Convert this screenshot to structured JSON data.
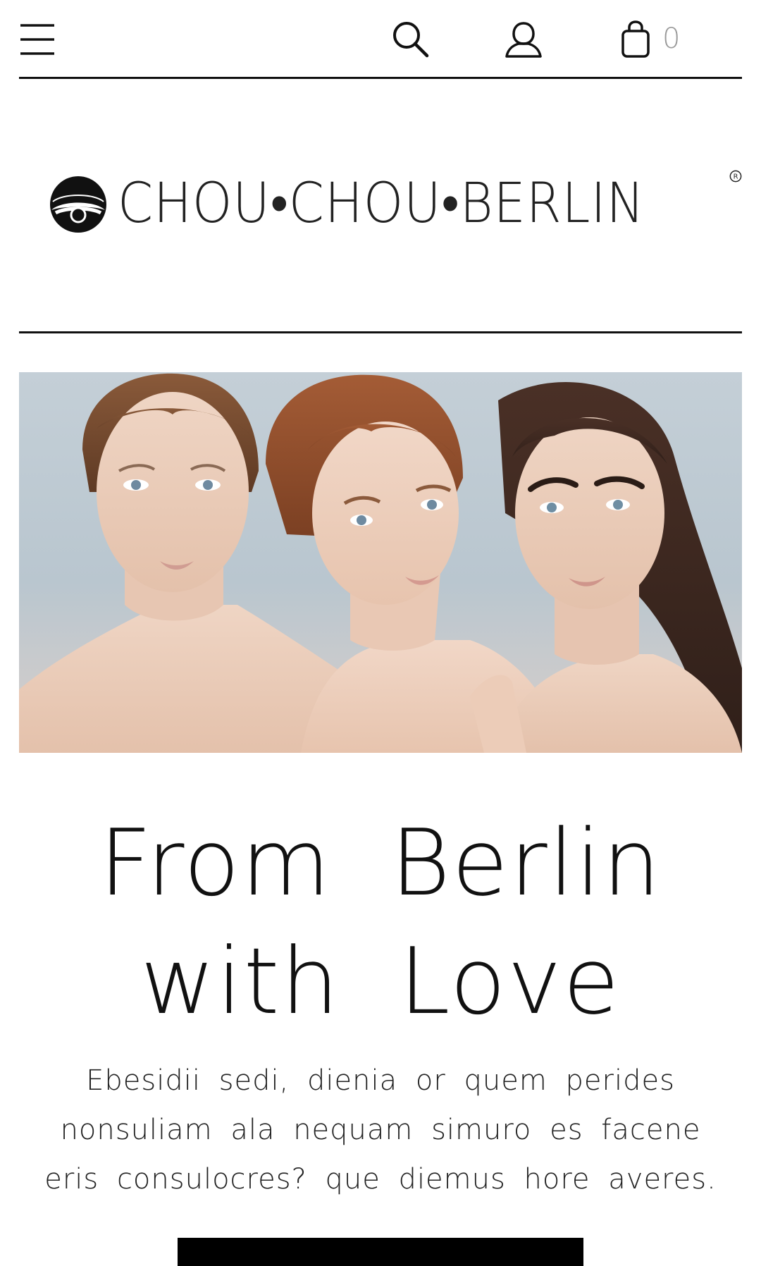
{
  "header": {
    "menu_icon": "hamburger-menu-icon",
    "search_icon": "search-icon",
    "account_icon": "user-account-icon",
    "cart_icon": "shopping-bag-icon",
    "cart_count": "0"
  },
  "brand": {
    "name": "CHOU•CHOU•BERLIN",
    "registered_mark": "registered-trademark-icon",
    "logo_icon": "eye-logo-icon"
  },
  "hero": {
    "image": "three-models-portrait"
  },
  "intro": {
    "headline_line1": "From Berlin",
    "headline_line2": "with Love",
    "body": "Ebesidii sedi, dienia or quem perides nonsuliam ala nequam simuro es facene eris consulocres? que diemus hore averes."
  },
  "colors": {
    "text": "#111111",
    "muted": "#9a9a9a",
    "background": "#ffffff",
    "button": "#000000"
  }
}
